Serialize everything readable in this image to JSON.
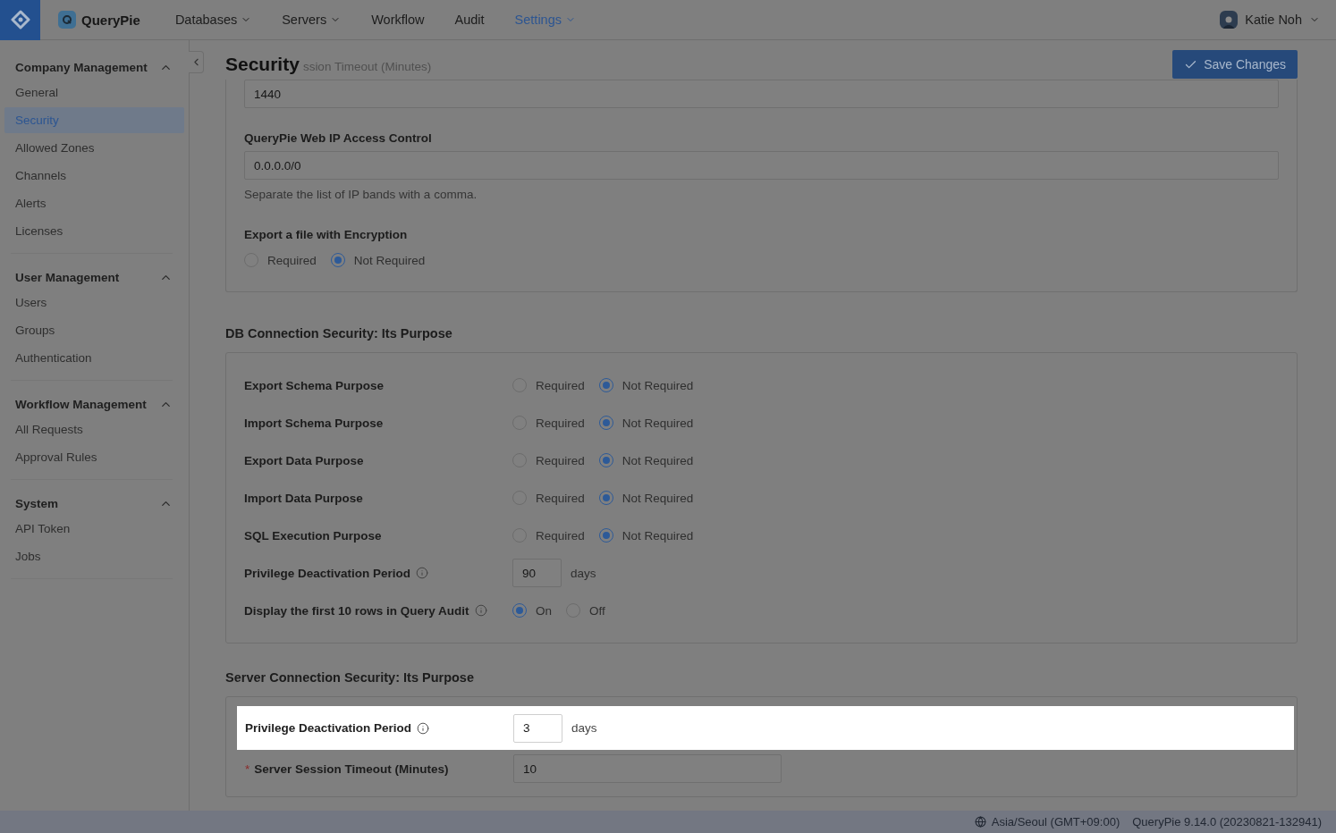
{
  "topbar": {
    "brand": "QueryPie",
    "nav": [
      {
        "label": "Databases",
        "dropdown": true,
        "selected": false
      },
      {
        "label": "Servers",
        "dropdown": true,
        "selected": false
      },
      {
        "label": "Workflow",
        "dropdown": false,
        "selected": false
      },
      {
        "label": "Audit",
        "dropdown": false,
        "selected": false
      },
      {
        "label": "Settings",
        "dropdown": true,
        "selected": true
      }
    ],
    "user": {
      "name": "Katie Noh"
    }
  },
  "sidebar": {
    "groups": [
      {
        "title": "Company Management",
        "expanded": true,
        "items": [
          {
            "label": "General",
            "selected": false
          },
          {
            "label": "Security",
            "selected": true
          },
          {
            "label": "Allowed Zones",
            "selected": false
          },
          {
            "label": "Channels",
            "selected": false
          },
          {
            "label": "Alerts",
            "selected": false
          },
          {
            "label": "Licenses",
            "selected": false
          }
        ]
      },
      {
        "title": "User Management",
        "expanded": true,
        "items": [
          {
            "label": "Users",
            "selected": false
          },
          {
            "label": "Groups",
            "selected": false
          },
          {
            "label": "Authentication",
            "selected": false
          }
        ]
      },
      {
        "title": "Workflow Management",
        "expanded": true,
        "items": [
          {
            "label": "All Requests",
            "selected": false
          },
          {
            "label": "Approval Rules",
            "selected": false
          }
        ]
      },
      {
        "title": "System",
        "expanded": true,
        "items": [
          {
            "label": "API Token",
            "selected": false
          },
          {
            "label": "Jobs",
            "selected": false
          }
        ]
      }
    ]
  },
  "page": {
    "title": "Security",
    "scrolled_label": "ssion Timeout (Minutes)",
    "save_button": "Save Changes"
  },
  "general_card": {
    "fields": [
      {
        "kind": "input",
        "value": "1440"
      },
      {
        "kind": "input",
        "label": "QueryPie Web IP Access Control",
        "value": "0.0.0.0/0",
        "help": "Separate the list of IP bands with a comma."
      },
      {
        "kind": "radio",
        "label": "Export a file with Encryption",
        "options": [
          {
            "label": "Required",
            "selected": false
          },
          {
            "label": "Not Required",
            "selected": true
          }
        ]
      }
    ]
  },
  "sections": [
    {
      "title": "DB Connection Security: Its Purpose",
      "rows": [
        {
          "kind": "radio",
          "label": "Export Schema Purpose",
          "info": false,
          "options": [
            {
              "label": "Required",
              "selected": false
            },
            {
              "label": "Not Required",
              "selected": true
            }
          ]
        },
        {
          "kind": "radio",
          "label": "Import Schema Purpose",
          "info": false,
          "options": [
            {
              "label": "Required",
              "selected": false
            },
            {
              "label": "Not Required",
              "selected": true
            }
          ]
        },
        {
          "kind": "radio",
          "label": "Export Data Purpose",
          "info": false,
          "options": [
            {
              "label": "Required",
              "selected": false
            },
            {
              "label": "Not Required",
              "selected": true
            }
          ]
        },
        {
          "kind": "radio",
          "label": "Import Data Purpose",
          "info": false,
          "options": [
            {
              "label": "Required",
              "selected": false
            },
            {
              "label": "Not Required",
              "selected": true
            }
          ]
        },
        {
          "kind": "radio",
          "label": "SQL Execution Purpose",
          "info": false,
          "options": [
            {
              "label": "Required",
              "selected": false
            },
            {
              "label": "Not Required",
              "selected": true
            }
          ]
        },
        {
          "kind": "days",
          "label": "Privilege Deactivation Period",
          "info": true,
          "value": "90",
          "unit": "days"
        },
        {
          "kind": "radio",
          "label": "Display the first 10 rows in Query Audit",
          "info": true,
          "options": [
            {
              "label": "On",
              "selected": true
            },
            {
              "label": "Off",
              "selected": false
            }
          ]
        }
      ]
    },
    {
      "title": "Server Connection Security: Its Purpose",
      "rows": [
        {
          "kind": "days",
          "label": "Privilege Deactivation Period",
          "info": true,
          "highlighted": true,
          "value": "3",
          "unit": "days"
        },
        {
          "kind": "input",
          "label": "Server Session Timeout (Minutes)",
          "required_mark": "*",
          "value": "10"
        }
      ]
    }
  ],
  "footer": {
    "timezone": "Asia/Seoul (GMT+09:00)",
    "version": "QueryPie 9.14.0 (20230821-132941)"
  }
}
